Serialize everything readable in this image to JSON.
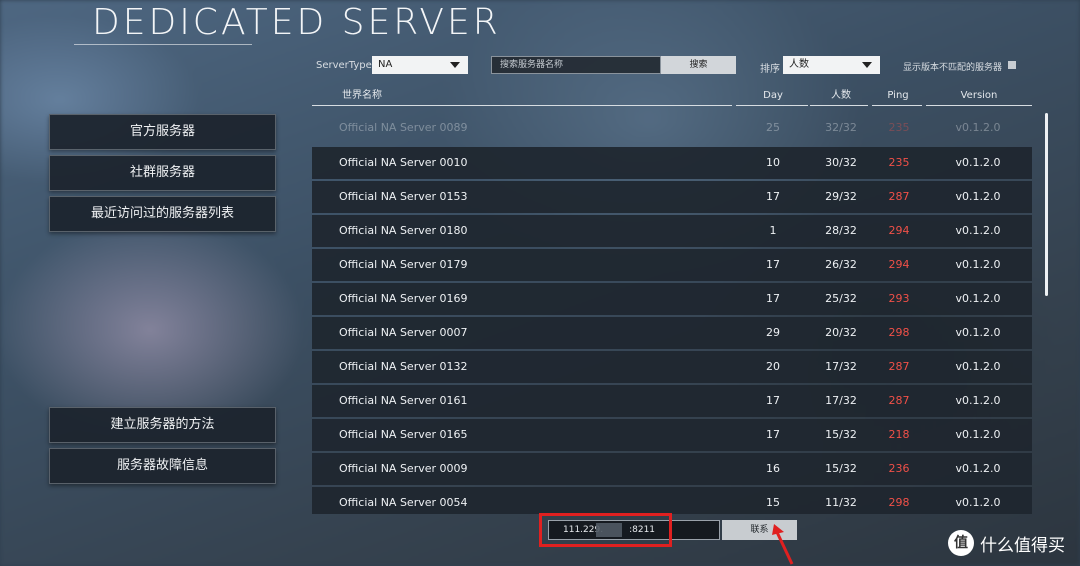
{
  "title": "DEDICATED SERVER",
  "filters": {
    "server_type_label": "ServerType",
    "server_type_value": "NA",
    "search_placeholder": "搜索服务器名称",
    "search_button": "搜索",
    "sort_label": "排序",
    "sort_value": "人数",
    "mismatch_label": "显示版本不匹配的服务器"
  },
  "table": {
    "headers": {
      "name": "世界名称",
      "day": "Day",
      "players": "人数",
      "ping": "Ping",
      "version": "Version"
    },
    "rows": [
      {
        "name": "Official NA Server 0089",
        "day": "25",
        "players": "32/32",
        "ping": "235",
        "version": "v0.1.2.0"
      },
      {
        "name": "Official NA Server 0010",
        "day": "10",
        "players": "30/32",
        "ping": "235",
        "version": "v0.1.2.0"
      },
      {
        "name": "Official NA Server 0153",
        "day": "17",
        "players": "29/32",
        "ping": "287",
        "version": "v0.1.2.0"
      },
      {
        "name": "Official NA Server 0180",
        "day": "1",
        "players": "28/32",
        "ping": "294",
        "version": "v0.1.2.0"
      },
      {
        "name": "Official NA Server 0179",
        "day": "17",
        "players": "26/32",
        "ping": "294",
        "version": "v0.1.2.0"
      },
      {
        "name": "Official NA Server 0169",
        "day": "17",
        "players": "25/32",
        "ping": "293",
        "version": "v0.1.2.0"
      },
      {
        "name": "Official NA Server 0007",
        "day": "29",
        "players": "20/32",
        "ping": "298",
        "version": "v0.1.2.0"
      },
      {
        "name": "Official NA Server 0132",
        "day": "20",
        "players": "17/32",
        "ping": "287",
        "version": "v0.1.2.0"
      },
      {
        "name": "Official NA Server 0161",
        "day": "17",
        "players": "17/32",
        "ping": "287",
        "version": "v0.1.2.0"
      },
      {
        "name": "Official NA Server 0165",
        "day": "17",
        "players": "15/32",
        "ping": "218",
        "version": "v0.1.2.0"
      },
      {
        "name": "Official NA Server 0009",
        "day": "16",
        "players": "15/32",
        "ping": "236",
        "version": "v0.1.2.0"
      },
      {
        "name": "Official NA Server 0054",
        "day": "15",
        "players": "11/32",
        "ping": "298",
        "version": "v0.1.2.0"
      }
    ]
  },
  "nav": {
    "official": "官方服务器",
    "community": "社群服务器",
    "recent": "最近访问过的服务器列表",
    "how_to": "建立服务器的方法",
    "troubleshoot": "服务器故障信息"
  },
  "connect": {
    "address_prefix": "111.229.",
    "address_port": ":8211",
    "connect_button": "联系"
  },
  "watermark": {
    "logo": "值",
    "text": "什么值得买"
  },
  "colors": {
    "ping": "#f05048",
    "annotation": "#e02020"
  }
}
